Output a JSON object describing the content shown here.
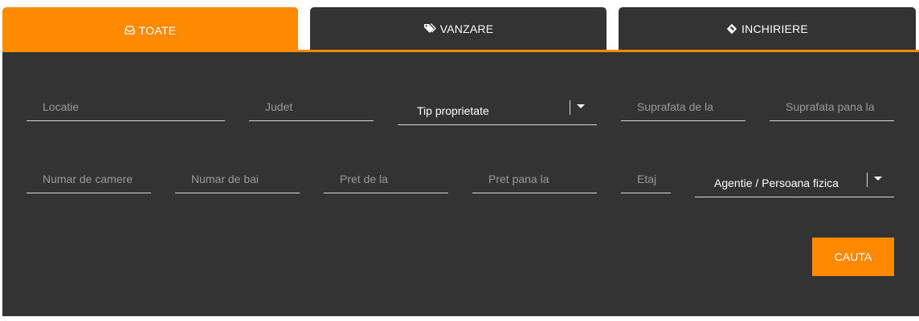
{
  "tabs": [
    {
      "label": "TOATE",
      "icon": "inbox-icon",
      "active": true
    },
    {
      "label": "VANZARE",
      "icon": "tags-icon",
      "active": false
    },
    {
      "label": "INCHIRIERE",
      "icon": "ticket-icon",
      "active": false
    }
  ],
  "colors": {
    "accent": "#ff8a00",
    "panel": "#333333"
  },
  "form": {
    "row1": {
      "locatie": {
        "placeholder": "Locatie",
        "value": ""
      },
      "judet": {
        "placeholder": "Judet",
        "value": ""
      },
      "tip_proprietate": {
        "selected": "Tip proprietate"
      },
      "suprafata_de_la": {
        "placeholder": "Suprafata de la",
        "value": ""
      },
      "suprafata_pana_la": {
        "placeholder": "Suprafata pana la",
        "value": ""
      }
    },
    "row2": {
      "numar_camere": {
        "placeholder": "Numar de camere",
        "value": ""
      },
      "numar_bai": {
        "placeholder": "Numar de bai",
        "value": ""
      },
      "pret_de_la": {
        "placeholder": "Pret de la",
        "value": ""
      },
      "pret_pana_la": {
        "placeholder": "Pret pana la",
        "value": ""
      },
      "etaj": {
        "placeholder": "Etaj",
        "value": ""
      },
      "agentie": {
        "selected": "Agentie / Persoana fizica"
      }
    },
    "submit_label": "CAUTA"
  }
}
